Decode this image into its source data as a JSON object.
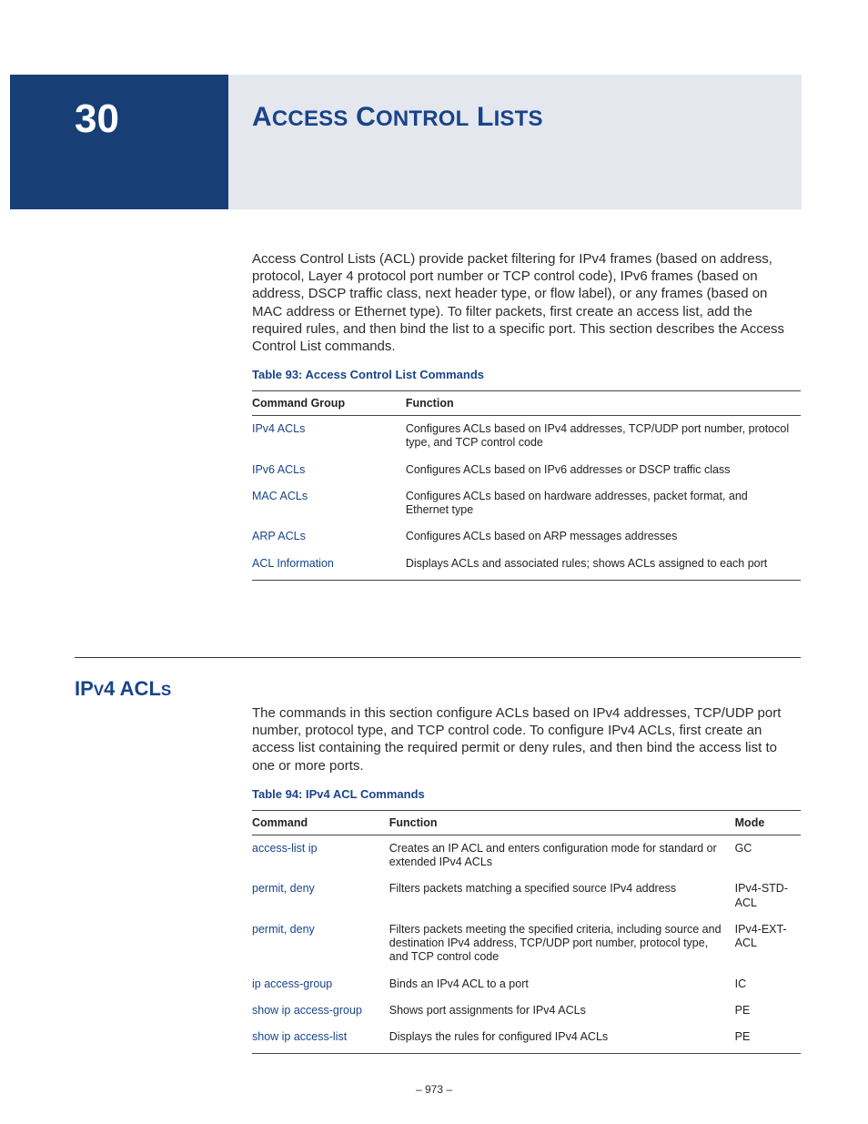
{
  "chapter": {
    "number": "30",
    "title_parts": [
      "A",
      "CCESS",
      " C",
      "ONTROL",
      " L",
      "ISTS"
    ]
  },
  "intro": "Access Control Lists (ACL) provide packet filtering for IPv4 frames (based on address, protocol, Layer 4 protocol port number or TCP control code), IPv6 frames (based on address, DSCP traffic class, next header type, or flow label), or any frames (based on MAC address or Ethernet type). To filter packets, first create an access list, add the required rules, and then bind the list to a specific port. This section describes the Access Control List commands.",
  "table93": {
    "title": "Table 93: Access Control List Commands",
    "headers": {
      "group": "Command Group",
      "function": "Function"
    },
    "rows": [
      {
        "group": "IPv4 ACLs",
        "fn": "Configures ACLs based on IPv4 addresses, TCP/UDP port number, protocol type, and TCP control code"
      },
      {
        "group": "IPv6 ACLs",
        "fn": "Configures ACLs based on IPv6 addresses or DSCP traffic class"
      },
      {
        "group": "MAC ACLs",
        "fn": "Configures ACLs based on hardware addresses, packet format, and Ethernet type"
      },
      {
        "group": "ARP ACLs",
        "fn": "Configures ACLs based on ARP messages addresses"
      },
      {
        "group": "ACL Information",
        "fn": "Displays ACLs and associated rules; shows ACLs assigned to each port"
      }
    ]
  },
  "section": {
    "title_parts": [
      "IP",
      "V",
      "4 ACL",
      "S"
    ]
  },
  "section_intro": "The commands in this section configure ACLs based on IPv4 addresses, TCP/UDP port number, protocol type, and TCP control code. To configure IPv4 ACLs, first create an access list containing the required permit or deny rules, and then bind the access list to one or more ports.",
  "table94": {
    "title": "Table 94: IPv4 ACL Commands",
    "headers": {
      "cmd": "Command",
      "function": "Function",
      "mode": "Mode"
    },
    "rows": [
      {
        "cmd": "access-list ip",
        "fn": "Creates an IP ACL and enters configuration mode for standard or extended IPv4 ACLs",
        "mode": "GC"
      },
      {
        "cmd": "permit, deny",
        "fn": "Filters packets matching a specified source IPv4 address",
        "mode": "IPv4-STD-ACL"
      },
      {
        "cmd": "permit, deny",
        "fn": "Filters packets meeting the specified criteria, including source and destination IPv4 address, TCP/UDP port number, protocol type, and TCP control code",
        "mode": "IPv4-EXT-ACL"
      },
      {
        "cmd": "ip access-group",
        "fn": "Binds an IPv4 ACL to a port",
        "mode": "IC"
      },
      {
        "cmd": "show ip access-group",
        "fn": "Shows port assignments for IPv4 ACLs",
        "mode": "PE"
      },
      {
        "cmd": "show ip access-list",
        "fn": "Displays the rules for configured IPv4 ACLs",
        "mode": "PE"
      }
    ]
  },
  "page_number": "–  973  –"
}
